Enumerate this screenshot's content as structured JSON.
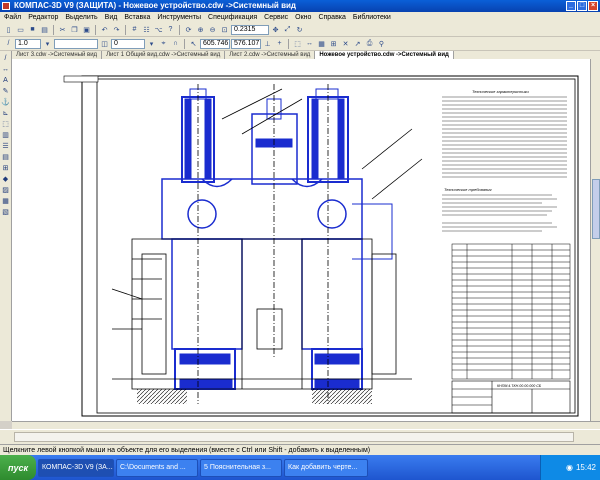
{
  "window": {
    "title": "КОМПАС-3D V9 (ЗАЩИТА) - Ножевое устройство.cdw ->Системный вид"
  },
  "menu": {
    "items": [
      "Файл",
      "Редактор",
      "Выделить",
      "Вид",
      "Вставка",
      "Инструменты",
      "Спецификация",
      "Сервис",
      "Окно",
      "Справка",
      "Библиотеки"
    ]
  },
  "toolbar": {
    "linewidth_value": "1.0",
    "layer_value": "0",
    "zoom_value": "0.2315",
    "coord_x": "605.746",
    "coord_y": "576.107"
  },
  "tabs": [
    {
      "label": "Лист 3.cdw ->Системный вид"
    },
    {
      "label": "Лист 1 Общий вид.cdw ->Системный вид"
    },
    {
      "label": "Лист 2.cdw ->Системный вид"
    },
    {
      "label": "Ножевое устройство.cdw ->Системный вид"
    }
  ],
  "drawing": {
    "stamp_text": "КНПМ.4.ТКН.00.00.000 СБ",
    "tech_title": "Технические характеристики",
    "notes_title": "Технические требования"
  },
  "status": {
    "text": "Щелкните левой кнопкой мыши на объекте для его выделения (вместе с Ctrl или Shift - добавить к выделенным)"
  },
  "taskbar": {
    "start_label": "пуск",
    "tasks": [
      {
        "label": "КОМПАС-3D V9 (ЗА..."
      },
      {
        "label": "C:\\Documents and ..."
      },
      {
        "label": "5 Пояснительная з..."
      },
      {
        "label": "Как добавить черте..."
      }
    ],
    "clock": "15:42"
  },
  "colors": {
    "drawing_blue": "#1a2ccf",
    "drawing_black": "#000000",
    "title_blue": "#0a5fd8"
  }
}
